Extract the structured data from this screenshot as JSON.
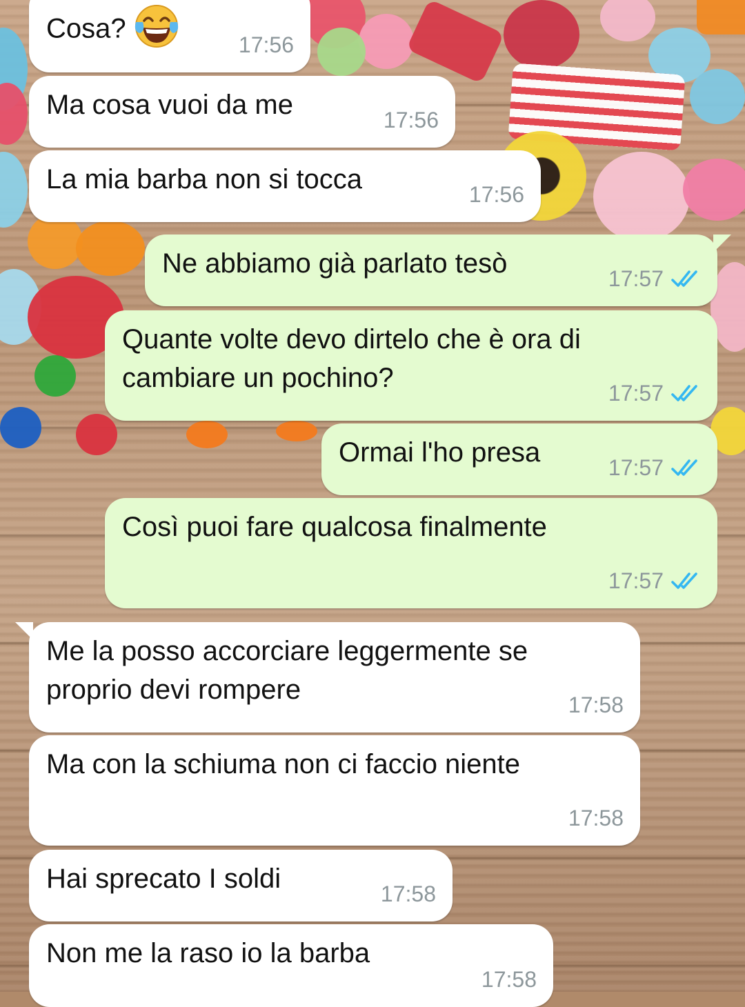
{
  "conversation": {
    "messages": [
      {
        "direction": "in",
        "text": "Cosa?",
        "emoji": "face-with-tears-of-joy",
        "time": "17:56"
      },
      {
        "direction": "in",
        "text": "Ma cosa vuoi da me",
        "time": "17:56"
      },
      {
        "direction": "in",
        "text": "La mia barba non si tocca",
        "time": "17:56"
      },
      {
        "direction": "out",
        "text": "Ne abbiamo già parlato tesò",
        "time": "17:57",
        "status": "read"
      },
      {
        "direction": "out",
        "text": "Quante volte devo dirtelo che è ora di\ncambiare un pochino?",
        "time": "17:57",
        "status": "read"
      },
      {
        "direction": "out",
        "text": "Ormai l'ho presa",
        "time": "17:57",
        "status": "read"
      },
      {
        "direction": "out",
        "text": "Così puoi fare qualcosa finalmente",
        "time": "17:57",
        "status": "read"
      },
      {
        "direction": "in",
        "text": "Me la posso accorciare leggermente se\nproprio devi rompere",
        "time": "17:58"
      },
      {
        "direction": "in",
        "text": "Ma con la schiuma non ci faccio niente",
        "time": "17:58"
      },
      {
        "direction": "in",
        "text": "Hai sprecato I soldi",
        "time": "17:58"
      },
      {
        "direction": "in",
        "text": "Non me la raso io la barba",
        "time": "17:58"
      }
    ]
  },
  "colors": {
    "incoming_bubble": "#ffffff",
    "outgoing_bubble": "#e4fbd0",
    "timestamp": "#8d979b",
    "read_ticks": "#34b7f1"
  },
  "icons": {
    "read_status": "double-check-icon",
    "emoji": "face-with-tears-of-joy-icon"
  }
}
